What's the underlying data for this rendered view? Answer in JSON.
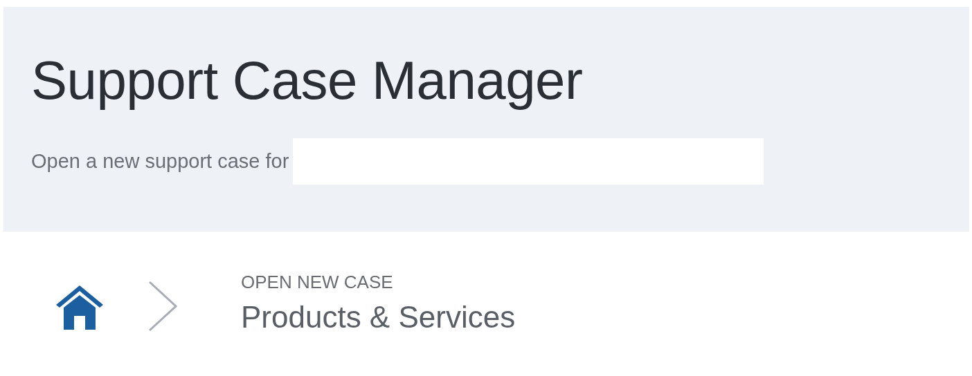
{
  "header": {
    "title": "Support Case Manager",
    "subtitle": "Open a new support case for"
  },
  "breadcrumb": {
    "step": "OPEN NEW CASE",
    "page": "Products & Services"
  }
}
